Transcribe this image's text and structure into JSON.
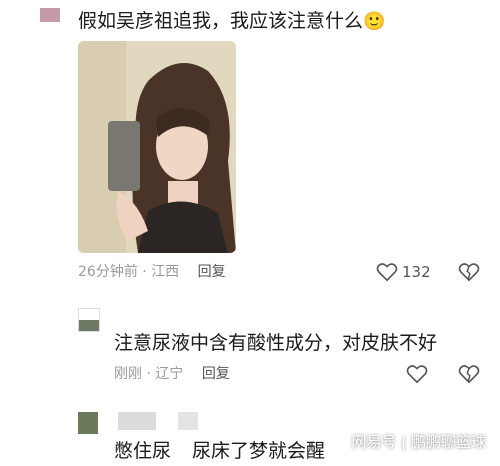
{
  "comments": [
    {
      "text": "假如吴彦祖追我，我应该注意什么",
      "emoji": "🙂",
      "time": "26分钟前",
      "location": "江西",
      "reply_label": "回复",
      "like_count": "132"
    },
    {
      "text": "注意尿液中含有酸性成分，对皮肤不好",
      "time": "刚刚",
      "location": "辽宁",
      "reply_label": "回复"
    },
    {
      "text_a": "憋住尿",
      "text_b": "尿床了梦就会醒"
    }
  ],
  "separator": "·",
  "watermark": "网易号 | 鹏鹏聊篮球",
  "colors": {
    "avatar_1": "#c49aa8",
    "avatar_2": "#6f7a66",
    "avatar_3": "#6b7a5a"
  }
}
